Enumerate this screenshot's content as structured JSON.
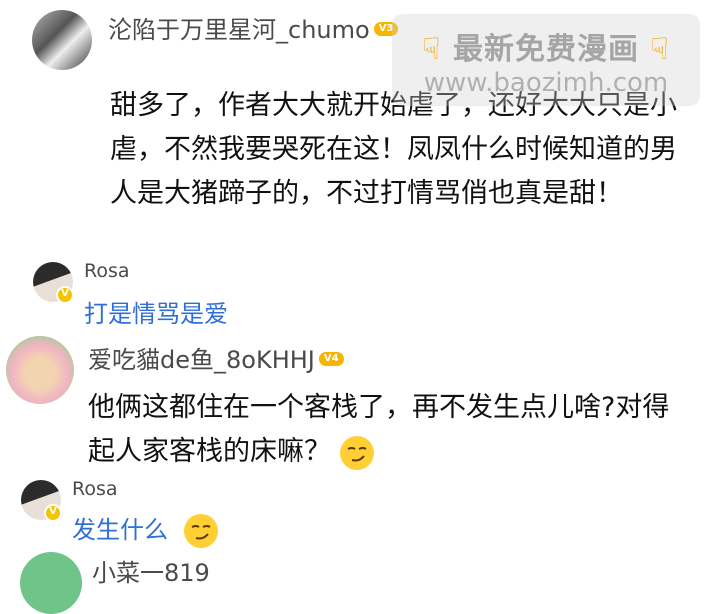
{
  "watermark": {
    "title": "最新免费漫画",
    "url": "www.baozimh.com",
    "icon": "pointing-hand-icon"
  },
  "comments": [
    {
      "user": "沦陷于万里星河_chumo",
      "badge": "V3",
      "text": "甜多了，作者大大就开始虐了，还好大大只是小虐，不然我要哭死在这！凤凤什么时候知道的男人是大猪蹄子的，不过打情骂俏也真是甜！"
    },
    {
      "user": "Rosa",
      "verified": "V",
      "text": "打是情骂是爱"
    },
    {
      "user": "爱吃貓de鱼_8oKHHJ",
      "badge": "V4",
      "text": "他俩这都住在一个客栈了，再不发生点儿啥?对得起人家客栈的床嘛？"
    },
    {
      "user": "Rosa",
      "verified": "V",
      "text": "发生什么"
    },
    {
      "user": "小菜一819"
    }
  ],
  "colors": {
    "reply_text": "#2f6fd6",
    "badge_gold": "#f7b500",
    "name_gray": "#4a4a4a"
  }
}
